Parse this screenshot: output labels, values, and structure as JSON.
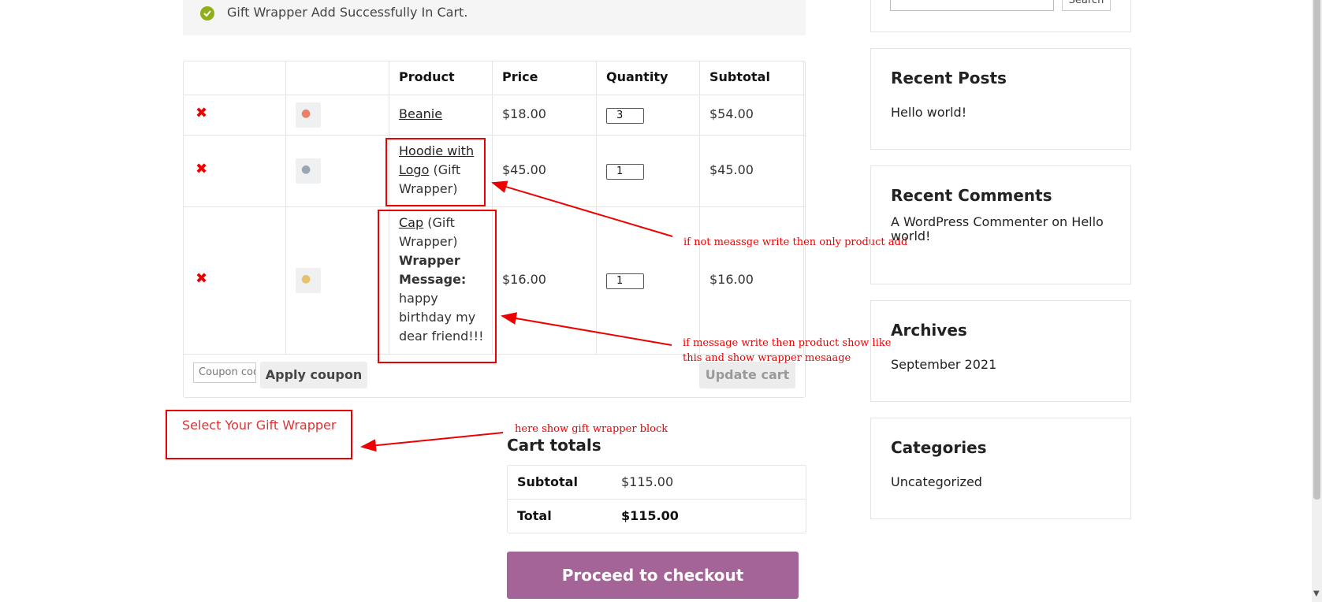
{
  "notice": {
    "message": "Gift Wrapper Add Successfully In Cart."
  },
  "cart": {
    "headers": {
      "product": "Product",
      "price": "Price",
      "quantity": "Quantity",
      "subtotal": "Subtotal"
    },
    "remove_symbol": "✖",
    "rows": [
      {
        "product": "Beanie",
        "price": "$18.00",
        "qty": "3",
        "subtotal": "$54.00"
      },
      {
        "product_l1": "Hoodie with",
        "product_l2": "Logo",
        "suffix_l2": " (Gift",
        "product_l3": "Wrapper)",
        "price": "$45.00",
        "qty": "1",
        "subtotal": "$45.00"
      },
      {
        "product": "Cap",
        "suffix": " (Gift",
        "wrapper_line": "Wrapper)",
        "msg_label_l1": "Wrapper",
        "msg_label_l2": "Message:",
        "msg_l1": "happy",
        "msg_l2": "birthday my",
        "msg_l3": "dear friend!!!",
        "price": "$16.00",
        "qty": "1",
        "subtotal": "$16.00"
      }
    ],
    "coupon_placeholder": "Coupon code",
    "apply_coupon": "Apply coupon",
    "update_cart": "Update cart"
  },
  "annotations": {
    "note1": "if not meassge write then only product add",
    "note2_l1": "if message write then product show like",
    "note2_l2": "this and show wrapper mesaage",
    "note3": "here show gift wrapper block"
  },
  "gift_wrapper": {
    "label": "Select Your Gift Wrapper"
  },
  "totals": {
    "title": "Cart totals",
    "subtotal_label": "Subtotal",
    "subtotal_value": "$115.00",
    "total_label": "Total",
    "total_value": "$115.00",
    "checkout": "Proceed to checkout"
  },
  "sidebar": {
    "search_button": "Search",
    "recent_posts_title": "Recent Posts",
    "recent_post_1": "Hello world!",
    "recent_comments_title": "Recent Comments",
    "comment_author": "A WordPress Commenter",
    "comment_on": " on ",
    "comment_post_l1": "Hello",
    "comment_post_l2": "world!",
    "archives_title": "Archives",
    "archive_1": "September 2021",
    "categories_title": "Categories",
    "category_1": "Uncategorized"
  },
  "colors": {
    "accent": "#a46497",
    "annotation": "#ee0000",
    "success": "#8fae1b"
  },
  "icons": {
    "notice": "check-circle-icon",
    "remove": "close-icon"
  }
}
